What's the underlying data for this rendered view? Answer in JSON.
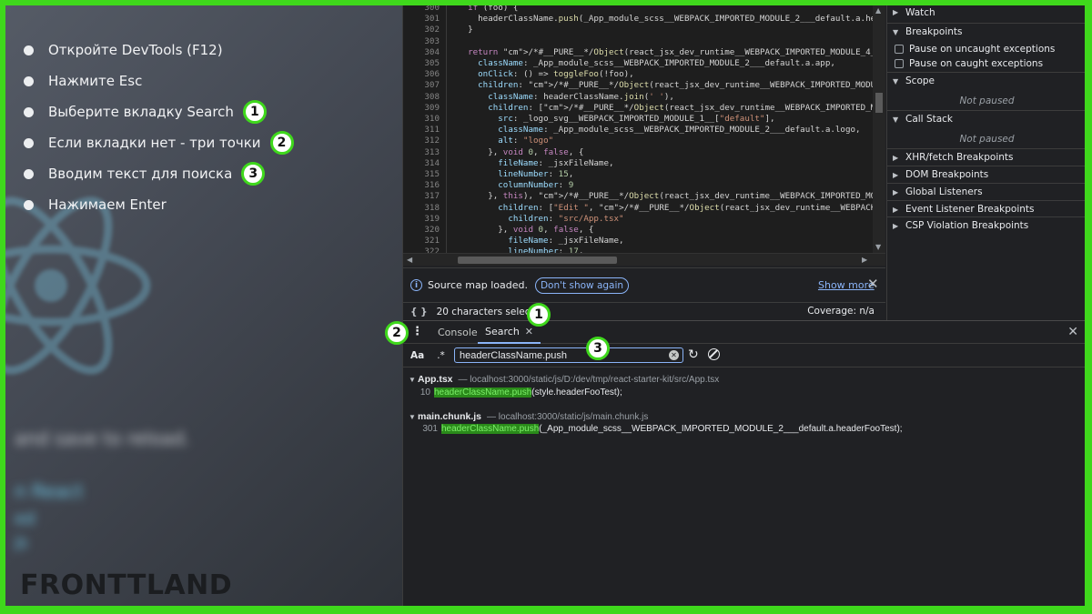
{
  "steps": [
    {
      "text": "Откройте DevTools (F12)",
      "badge": ""
    },
    {
      "text": "Нажмите Esc",
      "badge": ""
    },
    {
      "text": "Выберите вкладку Search",
      "badge": "1"
    },
    {
      "text": "Если вкладки нет - три точки",
      "badge": "2"
    },
    {
      "text": "Вводим текст для поиска",
      "badge": "3"
    },
    {
      "text": "Нажимаем Enter",
      "badge": ""
    }
  ],
  "brand": {
    "part1": "FRONTTLAND"
  },
  "background_blur_text": [
    "and save to reload.",
    "n React",
    "ed",
    "js"
  ],
  "editor": {
    "lines": [
      {
        "n": "300",
        "t": "  if (foo) {"
      },
      {
        "n": "301",
        "t": "    headerClassName.push(_App_module_scss__WEBPACK_IMPORTED_MODULE_2___default.a.hea"
      },
      {
        "n": "302",
        "t": "  }"
      },
      {
        "n": "303",
        "t": ""
      },
      {
        "n": "304",
        "t": "  return /*#__PURE__*/Object(react_jsx_dev_runtime__WEBPACK_IMPORTED_MODULE_4__[\"jsx"
      },
      {
        "n": "305",
        "t": "    className: _App_module_scss__WEBPACK_IMPORTED_MODULE_2___default.a.app,"
      },
      {
        "n": "306",
        "t": "    onClick: () => toggleFoo(!foo),"
      },
      {
        "n": "307",
        "t": "    children: /*#__PURE__*/Object(react_jsx_dev_runtime__WEBPACK_IMPORTED_MODULE_4__"
      },
      {
        "n": "308",
        "t": "      className: headerClassName.join(' '),"
      },
      {
        "n": "309",
        "t": "      children: [/*#__PURE__*/Object(react_jsx_dev_runtime__WEBPACK_IMPORTED_MODULE_"
      },
      {
        "n": "310",
        "t": "        src: _logo_svg__WEBPACK_IMPORTED_MODULE_1__[\"default\"],"
      },
      {
        "n": "311",
        "t": "        className: _App_module_scss__WEBPACK_IMPORTED_MODULE_2___default.a.logo,"
      },
      {
        "n": "312",
        "t": "        alt: \"logo\""
      },
      {
        "n": "313",
        "t": "      }, void 0, false, {"
      },
      {
        "n": "314",
        "t": "        fileName: _jsxFileName,"
      },
      {
        "n": "315",
        "t": "        lineNumber: 15,"
      },
      {
        "n": "316",
        "t": "        columnNumber: 9"
      },
      {
        "n": "317",
        "t": "      }, this), /*#__PURE__*/Object(react_jsx_dev_runtime__WEBPACK_IMPORTED_MODULE_4"
      },
      {
        "n": "318",
        "t": "        children: [\"Edit \", /*#__PURE__*/Object(react_jsx_dev_runtime__WEBPACK_IMPOR"
      },
      {
        "n": "319",
        "t": "          children: \"src/App.tsx\""
      },
      {
        "n": "320",
        "t": "        }, void 0, false, {"
      },
      {
        "n": "321",
        "t": "          fileName: _jsxFileName,"
      },
      {
        "n": "322",
        "t": "          lineNumber: 17,"
      }
    ]
  },
  "infobar": {
    "message": "Source map loaded.",
    "dont_show": "Don't show again",
    "show_more": "Show more"
  },
  "status": {
    "selection": "20 characters selected",
    "coverage": "Coverage: n/a"
  },
  "sidebar": {
    "watch": "Watch",
    "breakpoints": "Breakpoints",
    "pause_uncaught": "Pause on uncaught exceptions",
    "pause_caught": "Pause on caught exceptions",
    "scope": "Scope",
    "not_paused": "Not paused",
    "call_stack": "Call Stack",
    "sections": [
      "XHR/fetch Breakpoints",
      "DOM Breakpoints",
      "Global Listeners",
      "Event Listener Breakpoints",
      "CSP Violation Breakpoints"
    ]
  },
  "drawer": {
    "tab_console": "Console",
    "tab_search": "Search"
  },
  "search": {
    "case_toggle": "Aa",
    "regex_toggle": ".*",
    "query": "headerClassName.push"
  },
  "results": [
    {
      "file": "App.tsx",
      "path": "— localhost:3000/static/js/D:/dev/tmp/react-starter-kit/src/App.tsx",
      "line": "10",
      "match": "headerClassName.push",
      "rest": "(style.headerFooTest);"
    },
    {
      "file": "main.chunk.js",
      "path": "— localhost:3000/static/js/main.chunk.js",
      "line": "301",
      "match": "headerClassName.push",
      "rest": "(_App_module_scss__WEBPACK_IMPORTED_MODULE_2___default.a.headerFooTest);"
    }
  ],
  "callouts": {
    "c1": "1",
    "c2": "2",
    "c3": "3"
  },
  "colors": {
    "accent_green": "#3fd81c",
    "devtools_bg": "#202124",
    "link_blue": "#8ab4f8",
    "highlight": "#2a8a1a"
  }
}
